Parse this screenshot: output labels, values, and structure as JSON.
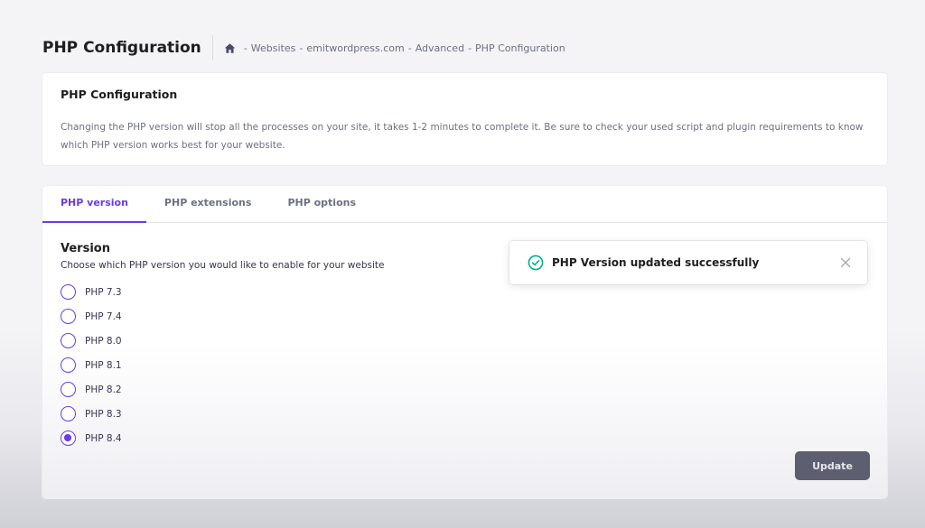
{
  "header": {
    "title": "PHP Configuration",
    "breadcrumb": {
      "icon": "home-icon",
      "items": [
        "Websites",
        "emitwordpress.com",
        "Advanced",
        "PHP Configuration"
      ],
      "separator": "-"
    }
  },
  "info_card": {
    "title": "PHP Configuration",
    "text": "Changing the PHP version will stop all the processes on your site, it takes 1-2 minutes to complete it. Be sure to check your used script and plugin requirements to know which PHP version works best for your website."
  },
  "tabs": [
    {
      "label": "PHP version",
      "active": true
    },
    {
      "label": "PHP extensions",
      "active": false
    },
    {
      "label": "PHP options",
      "active": false
    }
  ],
  "version_section": {
    "heading": "Version",
    "description": "Choose which PHP version you would like to enable for your website",
    "options": [
      {
        "label": "PHP 7.3",
        "selected": false
      },
      {
        "label": "PHP 7.4",
        "selected": false
      },
      {
        "label": "PHP 8.0",
        "selected": false
      },
      {
        "label": "PHP 8.1",
        "selected": false
      },
      {
        "label": "PHP 8.2",
        "selected": false
      },
      {
        "label": "PHP 8.3",
        "selected": false
      },
      {
        "label": "PHP 8.4",
        "selected": true
      }
    ]
  },
  "update_button": {
    "label": "Update"
  },
  "toast": {
    "message": "PHP Version updated successfully",
    "icon": "check-circle-icon",
    "close_icon": "close-icon"
  },
  "colors": {
    "accent": "#673de6",
    "success": "#00b090",
    "button_bg": "#5d5f70",
    "text_dark": "#1d1e20",
    "text_muted": "#6d7081"
  }
}
